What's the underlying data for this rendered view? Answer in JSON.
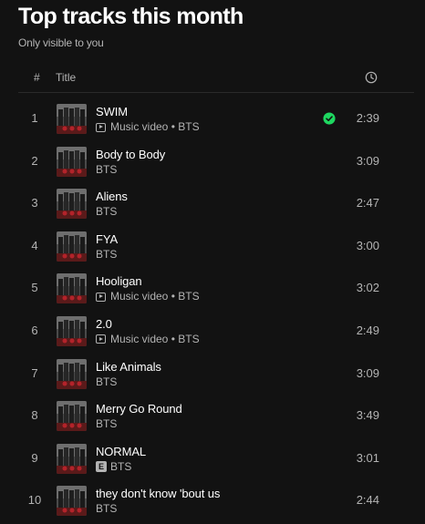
{
  "page": {
    "title": "Top tracks this month",
    "subtitle": "Only visible to you"
  },
  "header": {
    "number_label": "#",
    "title_label": "Title",
    "duration_icon": "clock-icon"
  },
  "colors": {
    "background": "#121212",
    "saved_check": "#1ed760",
    "secondary_text": "#b3b3b3"
  },
  "tracks": [
    {
      "number": "1",
      "name": "SWIM",
      "type": "Music video",
      "artist": "BTS",
      "explicit": false,
      "saved": true,
      "duration": "2:39"
    },
    {
      "number": "2",
      "name": "Body to Body",
      "type": "",
      "artist": "BTS",
      "explicit": false,
      "saved": false,
      "duration": "3:09"
    },
    {
      "number": "3",
      "name": "Aliens",
      "type": "",
      "artist": "BTS",
      "explicit": false,
      "saved": false,
      "duration": "2:47"
    },
    {
      "number": "4",
      "name": "FYA",
      "type": "",
      "artist": "BTS",
      "explicit": false,
      "saved": false,
      "duration": "3:00"
    },
    {
      "number": "5",
      "name": "Hooligan",
      "type": "Music video",
      "artist": "BTS",
      "explicit": false,
      "saved": false,
      "duration": "3:02"
    },
    {
      "number": "6",
      "name": "2.0",
      "type": "Music video",
      "artist": "BTS",
      "explicit": false,
      "saved": false,
      "duration": "2:49"
    },
    {
      "number": "7",
      "name": "Like Animals",
      "type": "",
      "artist": "BTS",
      "explicit": false,
      "saved": false,
      "duration": "3:09"
    },
    {
      "number": "8",
      "name": "Merry Go Round",
      "type": "",
      "artist": "BTS",
      "explicit": false,
      "saved": false,
      "duration": "3:49"
    },
    {
      "number": "9",
      "name": "NORMAL",
      "type": "",
      "artist": "BTS",
      "explicit": true,
      "saved": false,
      "duration": "3:01"
    },
    {
      "number": "10",
      "name": "they don't know 'bout us",
      "type": "",
      "artist": "BTS",
      "explicit": false,
      "saved": false,
      "duration": "2:44"
    }
  ]
}
